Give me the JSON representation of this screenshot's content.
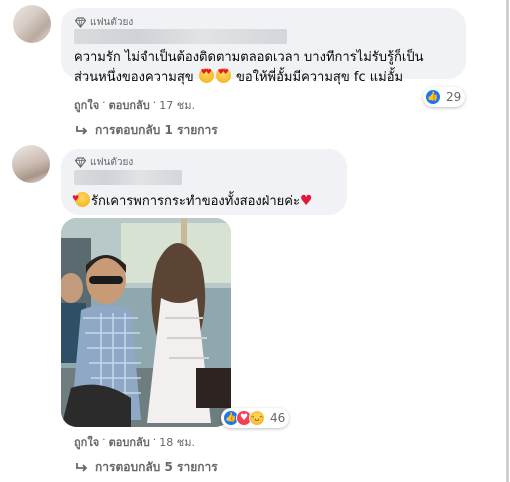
{
  "comment1": {
    "badge": "แฟนตัวยง",
    "line1": "ความรัก ไม่จำเป็นต้องติดตามตลอดเวลา บางทีการไม่รับรู้ก็เป็น",
    "line2_a": "ส่วนหนึ่งของความสุข",
    "line2_b": "ขอให้พี่อั้มมีความสุข fc แม่อั้ม",
    "reaction_count": "29",
    "like_label": "ถูกใจ",
    "reply_label": "ตอบกลับ",
    "time": "17 ชม.",
    "view_replies": "การตอบกลับ 1 รายการ"
  },
  "comment2": {
    "badge": "แฟนตัวยง",
    "text": "รักเคารพการกระทำของทั้งสองฝ่ายค่ะ",
    "reaction_count": "46",
    "like_label": "ถูกใจ",
    "reply_label": "ตอบกลับ",
    "time": "18 ชม.",
    "view_replies": "การตอบกลับ 5 รายการ"
  },
  "separator": "·",
  "icons": [
    "fan-badge-icon",
    "heart-eyes-emoji-icon",
    "kiss-emoji-icon",
    "red-heart-icon",
    "like-reaction-icon",
    "love-reaction-icon",
    "haha-reaction-icon",
    "reply-arrow-icon"
  ],
  "colors": {
    "bubble": "#f0f2f5",
    "meta_text": "#65676b",
    "like_blue": "#1877f2",
    "love_red": "#f33e58"
  }
}
